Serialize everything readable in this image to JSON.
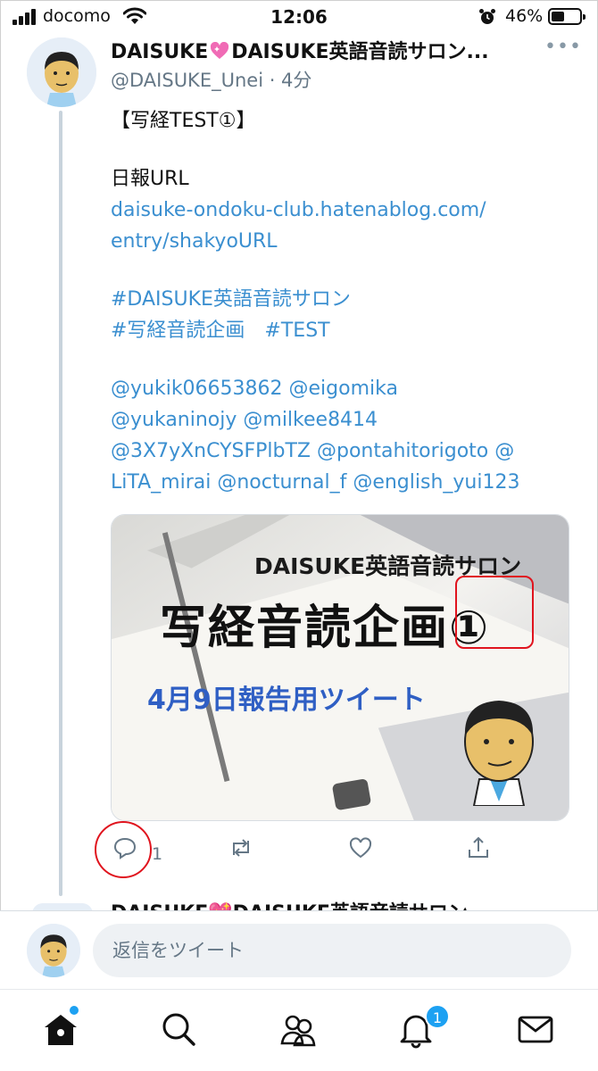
{
  "status_bar": {
    "carrier": "docomo",
    "time": "12:06",
    "battery_pct": "46%",
    "battery_level": 0.46,
    "icons": [
      "signal-icon",
      "wifi-icon",
      "alarm-icon",
      "battery-icon"
    ]
  },
  "tweet": {
    "display_name_a": "DAISUKE",
    "display_name_b": "DAISUKE英語音読サロン...",
    "name_emoji": "heart-sparkle-icon",
    "more_label": "•••",
    "handle_time": "@DAISUKE_Unei · 4分",
    "lines": {
      "title": "【写経TEST①】",
      "report_label": "日報URL",
      "url_line1": "daisuke-ondoku-club.hatenablog.com/",
      "url_line2": "entry/shakyoURL",
      "hashtags_line1": "#DAISUKE英語音読サロン",
      "hashtags_line2": "#写経音読企画　#TEST",
      "mentions_line1": "@yukik06653862 @eigomika",
      "mentions_line2": "@yukaninojy @milkee8414",
      "mentions_line3": "@3X7yXnCYSFPlbTZ @pontahitorigoto @",
      "mentions_line4": "LiTA_mirai @nocturnal_f @english_yui123"
    },
    "media": {
      "subtitle": "DAISUKE英語音読サロン",
      "headline": "写経音読企画①",
      "date_caption": "4月9日報告用ツイート"
    },
    "actions": {
      "reply_count": "1",
      "icons": [
        "reply-icon",
        "retweet-icon",
        "like-icon",
        "share-icon"
      ]
    },
    "accent_color": "#3b8fd0",
    "annotation_color": "#e0141e"
  },
  "next_tweet": {
    "name_peek": "DAISUKE💖DAISUKE英語音読サロン"
  },
  "reply_bar": {
    "placeholder": "返信をツイート"
  },
  "tab_bar": {
    "tabs": [
      "home-icon",
      "search-icon",
      "communities-icon",
      "notifications-icon",
      "messages-icon"
    ],
    "notifications_badge": "1",
    "brand_color": "#1da1f2"
  }
}
